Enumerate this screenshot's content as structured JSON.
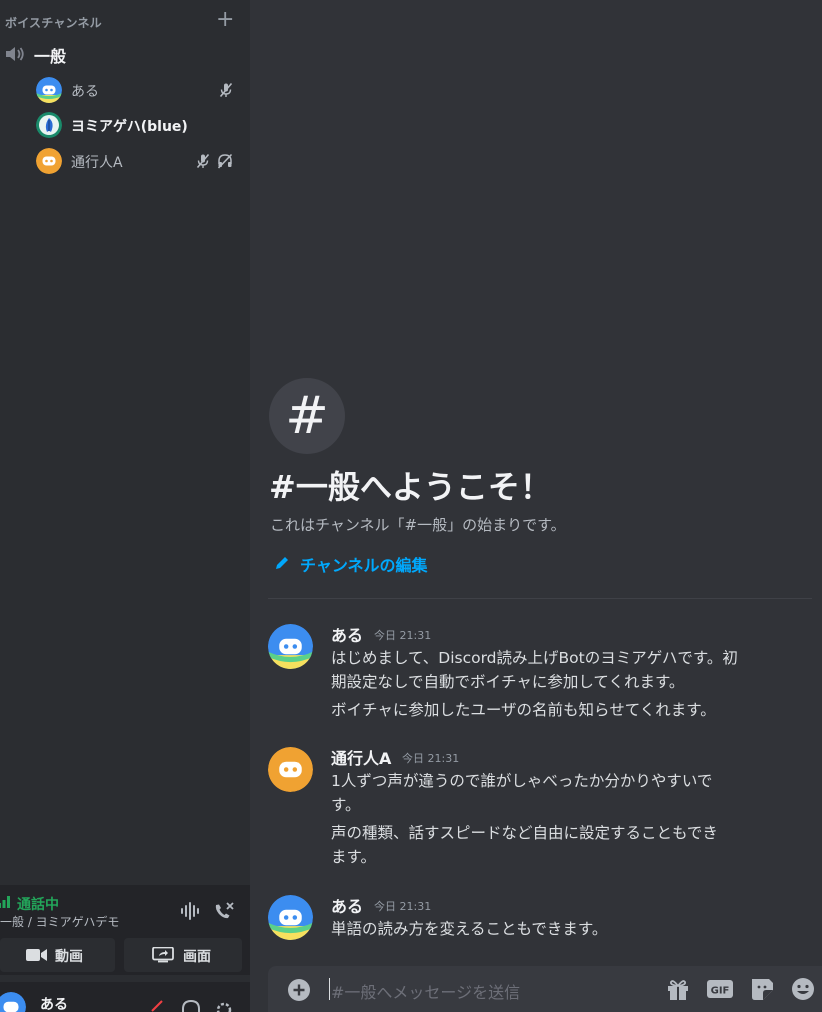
{
  "colors": {
    "background": "#313338",
    "sidebar": "#2b2d31",
    "panel": "#232428",
    "link": "#00a8fc",
    "connected": "#23a55a",
    "discord_blue": "#5865f2",
    "discord_orange": "#f0a232"
  },
  "sidebar": {
    "category_title": "ボイスチャンネル",
    "voice_channel": "一般",
    "voice_users": [
      {
        "name": "ある",
        "icons": [
          "mic-muted-icon"
        ]
      },
      {
        "name": "ヨミアゲハ(blue)",
        "icons": []
      },
      {
        "name": "通行人A",
        "icons": [
          "mic-muted-icon",
          "headphones-deafened-icon"
        ]
      }
    ],
    "voice_panel": {
      "status": "通話中",
      "location": "一般 / ヨミアゲハデモ",
      "video_label": "動画",
      "screen_label": "画面"
    },
    "current_user": "ある"
  },
  "main": {
    "welcome_symbol": "#",
    "welcome_title": "#一般へようこそ！",
    "welcome_subtitle": "これはチャンネル「#一般」の始まりです。",
    "edit_channel": "チャンネルの編集",
    "messages": [
      {
        "author": "ある",
        "time": "今日 21:31",
        "lines": [
          "はじめまして、Discord読み上げBotのヨミアゲハです。初",
          "期設定なしで自動でボイチャに参加してくれます。",
          "ボイチャに参加したユーザの名前も知らせてくれます。"
        ]
      },
      {
        "author": "通行人A",
        "time": "今日 21:31",
        "lines": [
          "1人ずつ声が違うので誰がしゃべったか分かりやすいで",
          "す。",
          "声の種類、話すスピードなど自由に設定することもでき",
          "ます。"
        ]
      },
      {
        "author": "ある",
        "time": "今日 21:31",
        "lines": [
          "単語の読み方を変えることもできます。"
        ]
      }
    ],
    "composer_placeholder": "#一般へメッセージを送信",
    "gif_label": "GIF"
  }
}
